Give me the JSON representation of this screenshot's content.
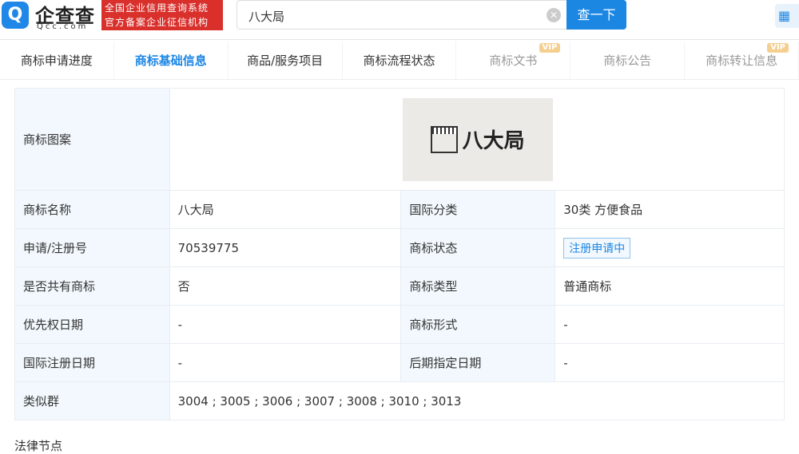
{
  "header": {
    "logo_mark": "Q",
    "logo_name": "企查查",
    "logo_domain": "Qcc.com",
    "badge_line1": "全国企业信用查询系统",
    "badge_line2": "官方备案企业征信机构",
    "search_value": "八大局",
    "search_button": "查一下",
    "apps_icon": "grid-icon"
  },
  "tabs": [
    {
      "label": "商标申请进度"
    },
    {
      "label": "商标基础信息",
      "active": true
    },
    {
      "label": "商品/服务项目"
    },
    {
      "label": "商标流程状态"
    },
    {
      "label": "商标文书",
      "vip": "VIP"
    },
    {
      "label": "商标公告"
    },
    {
      "label": "商标转让信息",
      "vip": "VIP"
    }
  ],
  "trademark": {
    "image_label": "商标图案",
    "image_text": "八大局"
  },
  "rows": [
    {
      "l1": "商标名称",
      "v1": "八大局",
      "l2": "国际分类",
      "v2": "30类 方便食品"
    },
    {
      "l1": "申请/注册号",
      "v1": "70539775",
      "l2": "商标状态",
      "v2": "注册申请中"
    },
    {
      "l1": "是否共有商标",
      "v1": "否",
      "l2": "商标类型",
      "v2": "普通商标"
    },
    {
      "l1": "优先权日期",
      "v1": "-",
      "l2": "商标形式",
      "v2": "-"
    },
    {
      "l1": "国际注册日期",
      "v1": "-",
      "l2": "后期指定日期",
      "v2": "-"
    }
  ],
  "similar": {
    "label": "类似群",
    "value": "3004 ; 3005 ; 3006 ; 3007 ; 3008 ; 3010 ; 3013"
  },
  "section_next": "法律节点",
  "colors": {
    "accent": "#1c86e3",
    "badge": "#d9302c",
    "label_bg": "#f2f8fd"
  }
}
